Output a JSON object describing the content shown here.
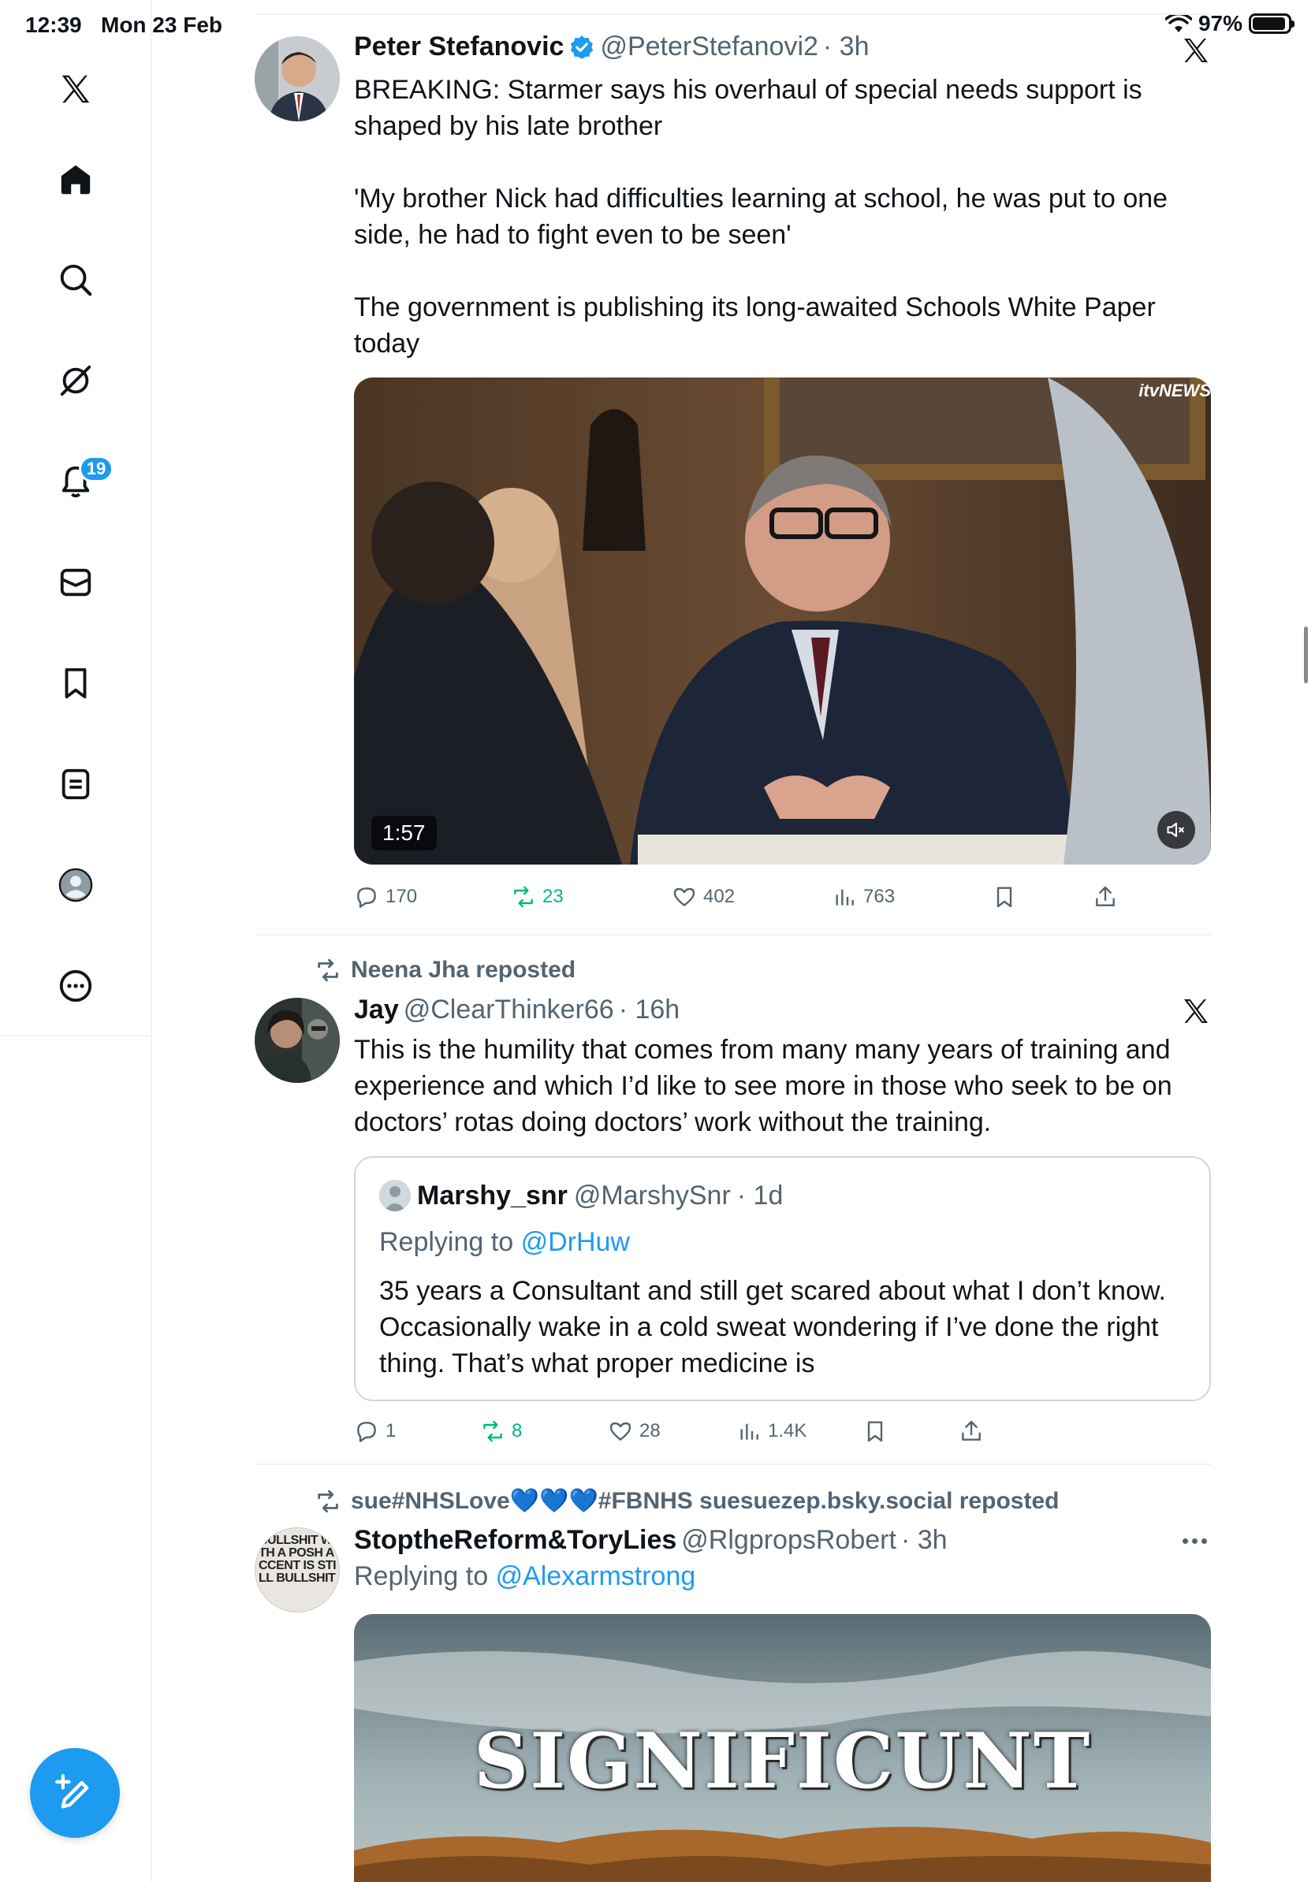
{
  "status_bar": {
    "time": "12:39",
    "date": "Mon 23 Feb",
    "battery": "97%"
  },
  "sidebar": {
    "items": [
      {
        "name": "logo",
        "label": "X"
      },
      {
        "name": "home",
        "label": "Home"
      },
      {
        "name": "explore",
        "label": "Explore"
      },
      {
        "name": "grok",
        "label": "Grok"
      },
      {
        "name": "notifications",
        "label": "Notifications",
        "badge": "19"
      },
      {
        "name": "messages",
        "label": "Messages"
      },
      {
        "name": "bookmarks",
        "label": "Bookmarks"
      },
      {
        "name": "lists",
        "label": "Lists"
      },
      {
        "name": "profile",
        "label": "Profile"
      },
      {
        "name": "more",
        "label": "More"
      }
    ],
    "compose_icon": "compose-icon"
  },
  "tweets": [
    {
      "name": "Peter Stefanovic",
      "verified": true,
      "handle": "@PeterStefanovi2",
      "time": "· 3h",
      "text": "BREAKING: Starmer says his overhaul of special needs support is shaped by his late brother\n\n'My brother Nick had difficulties learning at school, he was put to one side, he had to fight even to be seen'\n\nThe government is publishing its long-awaited Schools White Paper today",
      "media": {
        "duration": "1:57",
        "brand": "itvNEWS"
      },
      "stats": {
        "replies": "170",
        "reposts": "23",
        "likes": "402",
        "views": "763"
      }
    },
    {
      "reposted_by": "Neena Jha reposted",
      "name": "Jay",
      "handle": "@ClearThinker66",
      "time": "· 16h",
      "text": "This is the humility that comes from many many years of training and experience and which I’d like to see more in those who seek to be on doctors’ rotas doing doctors’ work without the training.",
      "quote": {
        "name": "Marshy_snr",
        "handle": "@MarshySnr",
        "time": "· 1d",
        "replying_label": "Replying to",
        "replying_to": "@DrHuw",
        "text": "35 years a Consultant and still get scared about what I don’t know. Occasionally wake in a cold sweat wondering if I’ve done the right thing. That’s what proper medicine is"
      },
      "stats": {
        "replies": "1",
        "reposts": "8",
        "likes": "28",
        "views": "1.4K"
      }
    },
    {
      "reposted_by": "sue#NHSLove💙💙💙#FBNHS suesuezep.bsky.social reposted",
      "name": "StoptheReform&ToryLies",
      "handle": "@RlgpropsRobert",
      "time": "· 3h",
      "avatar_text": "BULLSHIT WITH A POSH ACCENT IS STILL BULLSHIT",
      "replying_label": "Replying to",
      "replying_to": "@Alexarmstrong",
      "media_text": "SIGNIFICUNT"
    }
  ],
  "colors": {
    "accent": "#1d9bf0",
    "repost_green": "#00ba7c",
    "secondary_text": "#536471"
  }
}
